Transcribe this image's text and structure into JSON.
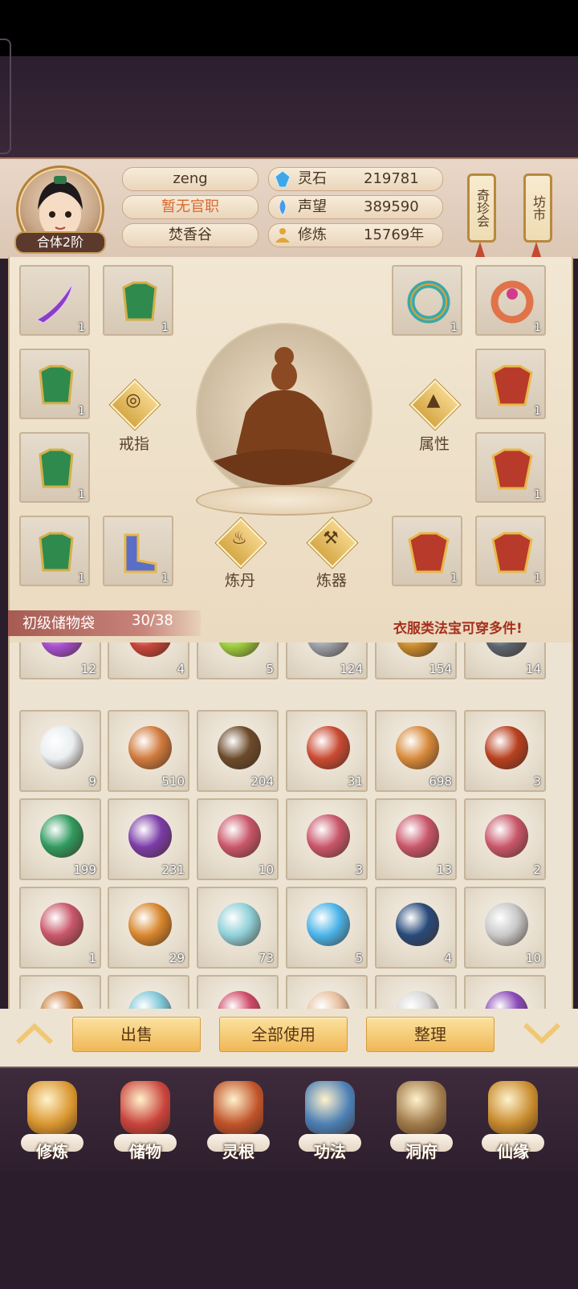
{
  "player": {
    "name": "zeng",
    "title": "暂无官职",
    "sect": "焚香谷",
    "rank": "合体2阶"
  },
  "resources": [
    {
      "label": "灵石",
      "value": "219781",
      "icon": "spirit-stone-icon",
      "color": "#3fa6e8"
    },
    {
      "label": "声望",
      "value": "389590",
      "icon": "reputation-icon",
      "color": "#4a9be6"
    },
    {
      "label": "修炼",
      "value": "15769年",
      "icon": "cultivation-icon",
      "color": "#e2a53b"
    }
  ],
  "side_buttons": {
    "treasure_fair": "奇珍会",
    "market": "坊市"
  },
  "equipment": {
    "slots": [
      {
        "count": "1",
        "icon": "purple-blade-icon"
      },
      {
        "count": "1",
        "icon": "green-armor-icon"
      },
      {
        "count": "1",
        "icon": "jade-bracelet-icon"
      },
      {
        "count": "1",
        "icon": "jewel-ring-icon"
      },
      {
        "count": "1",
        "icon": "green-armor-icon"
      },
      {
        "count": "1",
        "icon": "gold-armor-icon"
      },
      {
        "count": "1",
        "icon": "green-armor-icon"
      },
      {
        "count": "1",
        "icon": "gold-armor-icon"
      },
      {
        "count": "1",
        "icon": "green-armor-icon"
      },
      {
        "count": "1",
        "icon": "boots-icon"
      },
      {
        "count": "1",
        "icon": "gold-armor-icon"
      },
      {
        "count": "1",
        "icon": "gold-armor-icon"
      }
    ],
    "ring_label": "戒指",
    "attr_label": "属性",
    "alchemy_label": "炼丹",
    "forge_label": "炼器"
  },
  "bag": {
    "name": "初级储物袋",
    "count": "30/38",
    "hint": "衣服类法宝可穿多件!"
  },
  "inventory": [
    {
      "count": "12",
      "icon": "purple-orb-icon",
      "color": "#a64fd1"
    },
    {
      "count": "4",
      "icon": "red-orb-icon",
      "color": "#c9453a"
    },
    {
      "count": "5",
      "icon": "green-orb-icon",
      "color": "#9ccc3e"
    },
    {
      "count": "124",
      "icon": "silver-ore-icon",
      "color": "#9aa0a8"
    },
    {
      "count": "154",
      "icon": "gold-ore-icon",
      "color": "#c98a2a"
    },
    {
      "count": "14",
      "icon": "dark-ore-icon",
      "color": "#5c6470"
    },
    {
      "count": "9",
      "icon": "white-flower-icon",
      "color": "#e9eef0"
    },
    {
      "count": "510",
      "icon": "ginseng-icon",
      "color": "#d07a3c"
    },
    {
      "count": "204",
      "icon": "root-herb-icon",
      "color": "#6b4a2a"
    },
    {
      "count": "31",
      "icon": "red-flower-herb-icon",
      "color": "#c94a32"
    },
    {
      "count": "698",
      "icon": "cordyceps-icon",
      "color": "#d88a3a"
    },
    {
      "count": "3",
      "icon": "red-crystal-icon",
      "color": "#b8401f"
    },
    {
      "count": "199",
      "icon": "green-crystal-icon",
      "color": "#2f9a5e"
    },
    {
      "count": "231",
      "icon": "berry-branch-icon",
      "color": "#7b3ca8"
    },
    {
      "count": "10",
      "icon": "scroll-charm-icon",
      "color": "#c9566a"
    },
    {
      "count": "3",
      "icon": "scroll-charm-icon",
      "color": "#c9566a"
    },
    {
      "count": "13",
      "icon": "scroll-charm-icon",
      "color": "#c9566a"
    },
    {
      "count": "2",
      "icon": "scroll-charm-icon",
      "color": "#c9566a"
    },
    {
      "count": "1",
      "icon": "scroll-charm-icon",
      "color": "#c9566a"
    },
    {
      "count": "29",
      "icon": "gourd-icon",
      "color": "#d8862c"
    },
    {
      "count": "73",
      "icon": "potion-bottle-icon",
      "color": "#8fd0d8"
    },
    {
      "count": "5",
      "icon": "tea-bowl-icon",
      "color": "#4ab3e8"
    },
    {
      "count": "4",
      "icon": "star-chart-icon",
      "color": "#284a7a"
    },
    {
      "count": "10",
      "icon": "silver-coin-icon",
      "color": "#c8c8c8"
    },
    {
      "count": "",
      "icon": "partial-item-icon",
      "color": "#c97a3a"
    },
    {
      "count": "",
      "icon": "partial-item-icon",
      "color": "#7fc6d8"
    },
    {
      "count": "",
      "icon": "partial-item-icon",
      "color": "#d04a6a"
    },
    {
      "count": "",
      "icon": "partial-item-icon",
      "color": "#e8c0a0"
    },
    {
      "count": "",
      "icon": "partial-item-icon",
      "color": "#d8d8d8"
    },
    {
      "count": "",
      "icon": "partial-item-icon",
      "color": "#8a4ab8"
    }
  ],
  "actions": {
    "sell": "出售",
    "use_all": "全部使用",
    "sort": "整理"
  },
  "nav": [
    {
      "label": "修炼",
      "icon": "cultivate-monk-icon",
      "color": "#d9962f"
    },
    {
      "label": "储物",
      "icon": "storage-bag-icon",
      "color": "#c9433c"
    },
    {
      "label": "灵根",
      "icon": "spirit-root-icon",
      "color": "#c0532a"
    },
    {
      "label": "功法",
      "icon": "skill-book-icon",
      "color": "#4b7fb5"
    },
    {
      "label": "洞府",
      "icon": "cave-residence-icon",
      "color": "#a07a4a"
    },
    {
      "label": "仙缘",
      "icon": "immortal-fate-icon",
      "color": "#c78a2d"
    }
  ]
}
